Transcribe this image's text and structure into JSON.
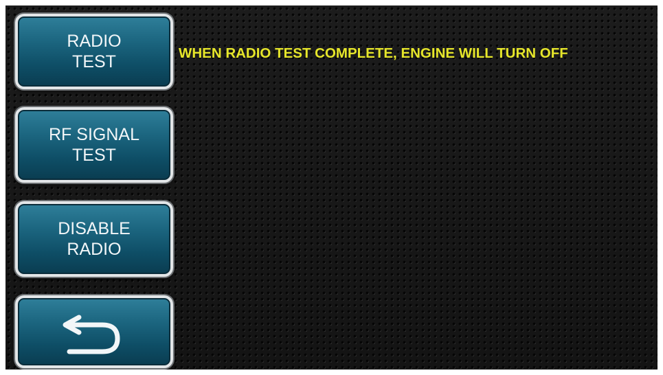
{
  "menu": {
    "radio_test_label": "RADIO\nTEST",
    "rf_signal_test_label": "RF SIGNAL\nTEST",
    "disable_radio_label": "DISABLE\nRADIO",
    "back_icon": "undo-arrow-icon"
  },
  "status": {
    "message": "WHEN RADIO TEST COMPLETE, ENGINE WILL TURN OFF"
  },
  "colors": {
    "button_blue": "#1c6680",
    "message_yellow": "#e6e62a",
    "background": "#1a1a1a"
  }
}
